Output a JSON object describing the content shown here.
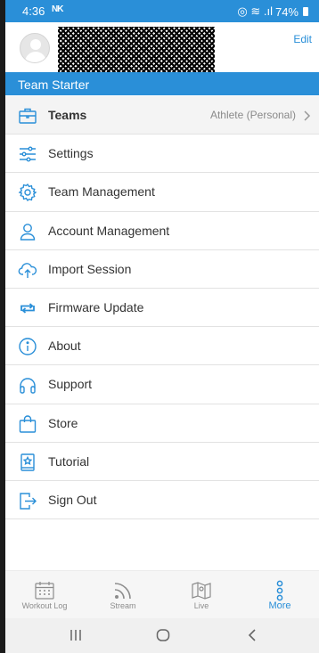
{
  "status_bar": {
    "time": "4:36",
    "notification": "NK",
    "signal": "◎ ≋ .ıl",
    "battery": "74%"
  },
  "profile": {
    "edit_label": "Edit"
  },
  "team_banner": {
    "title": "Team Starter"
  },
  "menu": {
    "items": [
      {
        "label": "Teams",
        "value": "Athlete (Personal)",
        "icon": "briefcase-icon"
      },
      {
        "label": "Settings",
        "icon": "sliders-icon"
      },
      {
        "label": "Team Management",
        "icon": "gear-icon"
      },
      {
        "label": "Account Management",
        "icon": "user-icon"
      },
      {
        "label": "Import Session",
        "icon": "cloud-upload-icon"
      },
      {
        "label": "Firmware Update",
        "icon": "sync-arrows-icon"
      },
      {
        "label": "About",
        "icon": "info-icon"
      },
      {
        "label": "Support",
        "icon": "headphones-icon"
      },
      {
        "label": "Store",
        "icon": "shopping-bag-icon"
      },
      {
        "label": "Tutorial",
        "icon": "book-star-icon"
      },
      {
        "label": "Sign Out",
        "icon": "sign-out-icon"
      }
    ]
  },
  "tabs": [
    {
      "label": "Workout Log",
      "icon": "calendar-icon"
    },
    {
      "label": "Stream",
      "icon": "rss-icon"
    },
    {
      "label": "Live",
      "icon": "map-icon"
    },
    {
      "label": "More",
      "icon": "more-dots-icon",
      "active": true
    }
  ],
  "colors": {
    "accent": "#2a8fd8",
    "text": "#333333",
    "muted": "#8a8a8a"
  }
}
